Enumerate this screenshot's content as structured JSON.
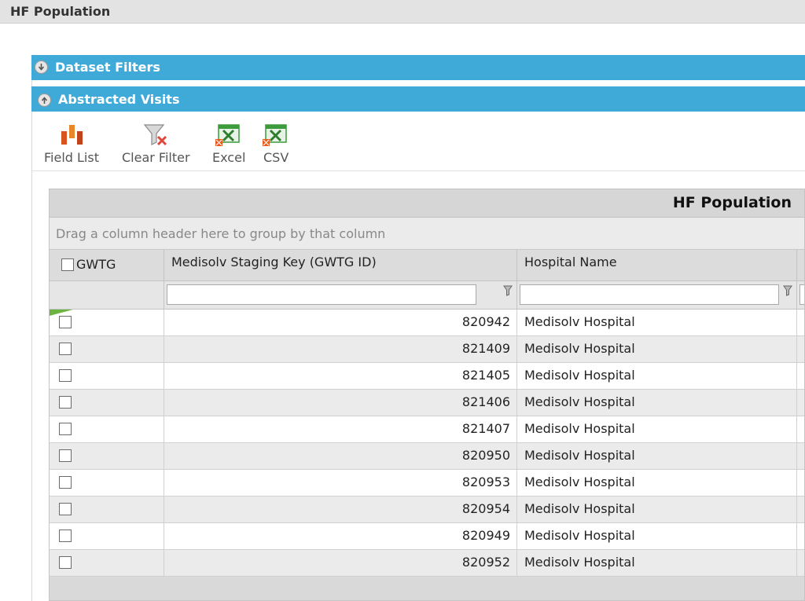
{
  "window": {
    "title": "HF Population"
  },
  "panels": {
    "dataset_filters": "Dataset Filters",
    "abstracted_visits": "Abstracted Visits"
  },
  "toolbar": {
    "field_list": "Field List",
    "clear_filter": "Clear Filter",
    "excel": "Excel",
    "csv": "CSV"
  },
  "grid": {
    "title": "HF Population",
    "group_hint": "Drag a column header here to group by that column",
    "columns": [
      "GWTG",
      "Medisolv Staging Key (GWTG ID)",
      "Hospital Name"
    ],
    "rows": [
      {
        "key": "820942",
        "hospital": "Medisolv Hospital"
      },
      {
        "key": "821409",
        "hospital": "Medisolv Hospital"
      },
      {
        "key": "821405",
        "hospital": "Medisolv Hospital"
      },
      {
        "key": "821406",
        "hospital": "Medisolv Hospital"
      },
      {
        "key": "821407",
        "hospital": "Medisolv Hospital"
      },
      {
        "key": "820950",
        "hospital": "Medisolv Hospital"
      },
      {
        "key": "820953",
        "hospital": "Medisolv Hospital"
      },
      {
        "key": "820954",
        "hospital": "Medisolv Hospital"
      },
      {
        "key": "820949",
        "hospital": "Medisolv Hospital"
      },
      {
        "key": "820952",
        "hospital": "Medisolv Hospital"
      }
    ]
  },
  "colors": {
    "panel_bar": "#3fa9d8",
    "title_bar": "#e3e3e3",
    "row_alt": "#ebebeb",
    "excel_green": "#3c9b3c",
    "field_list_orange": "#d9541e"
  }
}
